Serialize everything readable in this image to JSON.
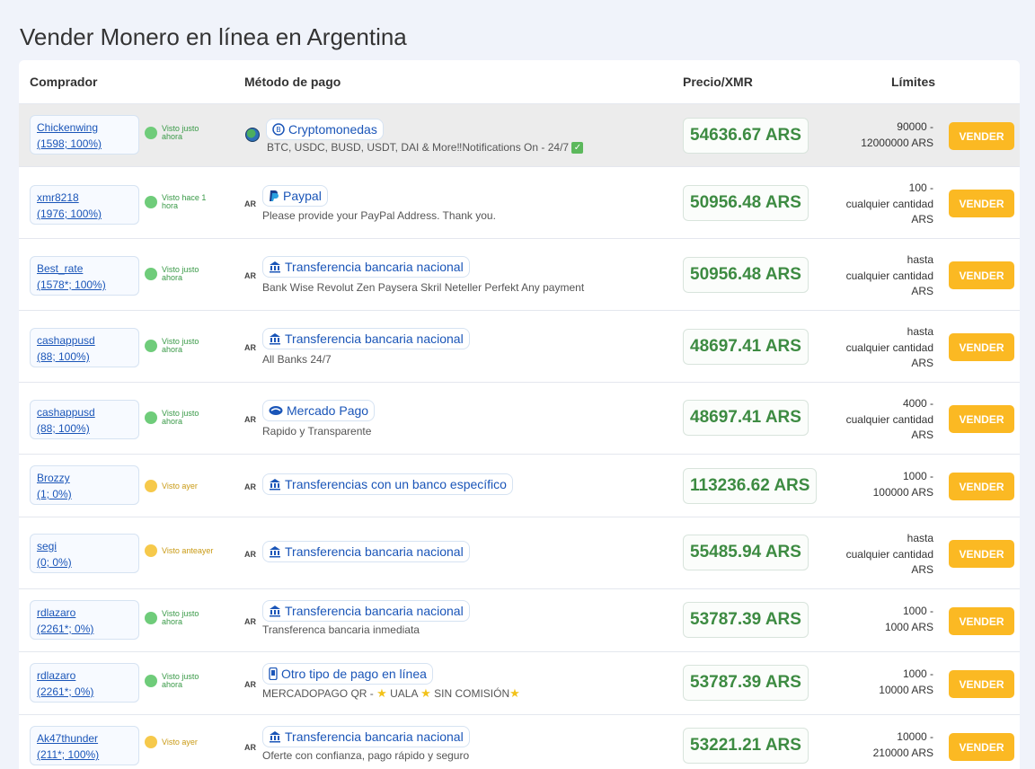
{
  "page": {
    "title": "Vender Monero en línea en Argentina"
  },
  "table": {
    "headers": {
      "buyer": "Comprador",
      "method": "Método de pago",
      "price": "Precio/XMR",
      "limits": "Límites"
    }
  },
  "rows": [
    {
      "user": "Chickenwing",
      "stats": "(1598; 100%)",
      "status": "Visto justo ahora",
      "status_color": "green",
      "country": "",
      "method": "Cryptomonedas",
      "method_icon": "crypto-icon",
      "desc": "BTC, USDC, BUSD, USDT, DAI & More‼Notifications On - 24/7",
      "price": "54636.67 ARS",
      "limits": [
        "90000 -",
        "12000000 ARS"
      ],
      "button": "VENDER",
      "highlight": true
    },
    {
      "user": "xmr8218",
      "stats": "(1976; 100%)",
      "status": "Visto hace 1 hora",
      "status_color": "green",
      "country": "AR",
      "method": "Paypal",
      "method_icon": "paypal-icon",
      "desc": "Please provide your PayPal Address. Thank you.",
      "price": "50956.48 ARS",
      "limits": [
        "100 -",
        "cualquier cantidad",
        "ARS"
      ],
      "button": "VENDER"
    },
    {
      "user": "Best_rate",
      "stats": "(1578*; 100%)",
      "status": "Visto justo ahora",
      "status_color": "green",
      "country": "AR",
      "method": "Transferencia bancaria nacional",
      "method_icon": "bank-icon",
      "desc": "Bank Wise Revolut Zen Paysera Skril Neteller Perfekt Any payment",
      "price": "50956.48 ARS",
      "limits": [
        "hasta",
        "cualquier cantidad",
        "ARS"
      ],
      "button": "VENDER"
    },
    {
      "user": "cashappusd",
      "stats": "(88; 100%)",
      "status": "Visto justo ahora",
      "status_color": "green",
      "country": "AR",
      "method": "Transferencia bancaria nacional",
      "method_icon": "bank-icon",
      "desc": "All Banks 24/7",
      "price": "48697.41 ARS",
      "limits": [
        "hasta",
        "cualquier cantidad",
        "ARS"
      ],
      "button": "VENDER"
    },
    {
      "user": "cashappusd",
      "stats": "(88; 100%)",
      "status": "Visto justo ahora",
      "status_color": "green",
      "country": "AR",
      "method": "Mercado Pago",
      "method_icon": "handshake-icon",
      "desc": "Rapido y Transparente",
      "price": "48697.41 ARS",
      "limits": [
        "4000 -",
        "cualquier cantidad",
        "ARS"
      ],
      "button": "VENDER"
    },
    {
      "user": "Brozzy",
      "stats": "(1; 0%)",
      "status": "Visto ayer",
      "status_color": "yellow",
      "country": "AR",
      "method": "Transferencias con un banco específico",
      "method_icon": "bank-icon",
      "desc": "",
      "price": "113236.62 ARS",
      "limits": [
        "1000 -",
        "100000 ARS"
      ],
      "button": "VENDER"
    },
    {
      "user": "segi",
      "stats": "(0; 0%)",
      "status": "Visto anteayer",
      "status_color": "yellow",
      "country": "AR",
      "method": "Transferencia bancaria nacional",
      "method_icon": "bank-icon",
      "desc": "",
      "price": "55485.94 ARS",
      "limits": [
        "hasta",
        "cualquier cantidad",
        "ARS"
      ],
      "button": "VENDER"
    },
    {
      "user": "rdlazaro",
      "stats": "(2261*; 0%)",
      "status": "Visto justo ahora",
      "status_color": "green",
      "country": "AR",
      "method": "Transferencia bancaria nacional",
      "method_icon": "bank-icon",
      "desc": "Transferenca bancaria inmediata",
      "price": "53787.39 ARS",
      "limits": [
        "1000 -",
        "1000 ARS"
      ],
      "button": "VENDER"
    },
    {
      "user": "rdlazaro",
      "stats": "(2261*; 0%)",
      "status": "Visto justo ahora",
      "status_color": "green",
      "country": "AR",
      "method": "Otro tipo de pago en línea",
      "method_icon": "phone-icon",
      "desc_parts": [
        "MERCADOPAGO QR - ",
        " UALA ",
        " SIN COMISIÓN"
      ],
      "price": "53787.39 ARS",
      "limits": [
        "1000 -",
        "10000 ARS"
      ],
      "button": "VENDER"
    },
    {
      "user": "Ak47thunder",
      "stats": "(211*; 100%)",
      "status": "Visto ayer",
      "status_color": "yellow",
      "country": "AR",
      "method": "Transferencia bancaria nacional",
      "method_icon": "bank-icon",
      "desc": "Oferte con confianza, pago rápido y seguro",
      "price": "53221.21 ARS",
      "limits": [
        "10000 -",
        "210000 ARS"
      ],
      "button": "VENDER"
    }
  ]
}
